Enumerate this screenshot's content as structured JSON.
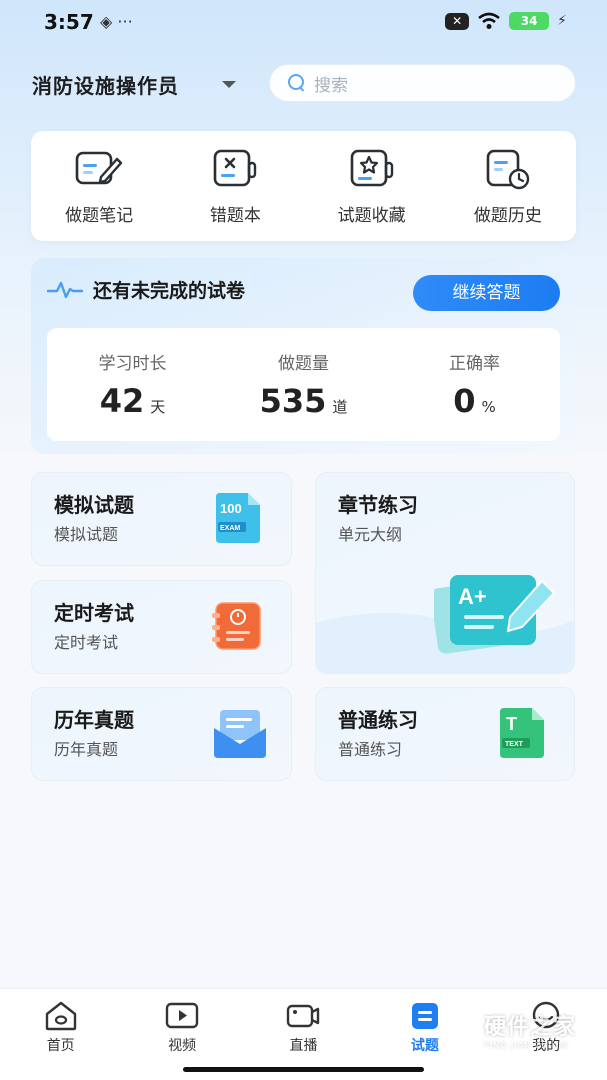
{
  "status_bar": {
    "time": "3:57",
    "battery": "34"
  },
  "header": {
    "role_title": "消防设施操作员",
    "search_placeholder": "搜索"
  },
  "tools": [
    {
      "label": "做题笔记",
      "icon": "note-edit-icon"
    },
    {
      "label": "错题本",
      "icon": "wrong-book-icon"
    },
    {
      "label": "试题收藏",
      "icon": "favorite-star-icon"
    },
    {
      "label": "做题历史",
      "icon": "history-clock-icon"
    }
  ],
  "exam_card": {
    "title": "还有未完成的试卷",
    "continue_label": "继续答题",
    "stats": [
      {
        "label": "学习时长",
        "value": "42",
        "unit": "天"
      },
      {
        "label": "做题量",
        "value": "535",
        "unit": "道"
      },
      {
        "label": "正确率",
        "value": "0",
        "unit": "%"
      }
    ]
  },
  "modules": {
    "mock": {
      "title": "模拟试题",
      "subtitle": "模拟试题",
      "icon_text": "100",
      "icon_badge": "EXAM"
    },
    "chapter": {
      "title": "章节练习",
      "subtitle": "单元大纲",
      "icon_text": "A+"
    },
    "timed": {
      "title": "定时考试",
      "subtitle": "定时考试"
    },
    "normal": {
      "title": "普通练习",
      "subtitle": "普通练习",
      "icon_text": "T",
      "icon_badge": "TEXT"
    },
    "past": {
      "title": "历年真题",
      "subtitle": "历年真题"
    }
  },
  "bottom_nav": [
    {
      "label": "首页",
      "active": false
    },
    {
      "label": "视频",
      "active": false
    },
    {
      "label": "直播",
      "active": false
    },
    {
      "label": "试题",
      "active": true
    },
    {
      "label": "我的",
      "active": false
    }
  ],
  "colors": {
    "accent": "#1f7ff2",
    "card_bg": "#edf5fd"
  },
  "watermark": {
    "main": "硬件之家",
    "sub": "YING JIAN ZHI JIA"
  }
}
